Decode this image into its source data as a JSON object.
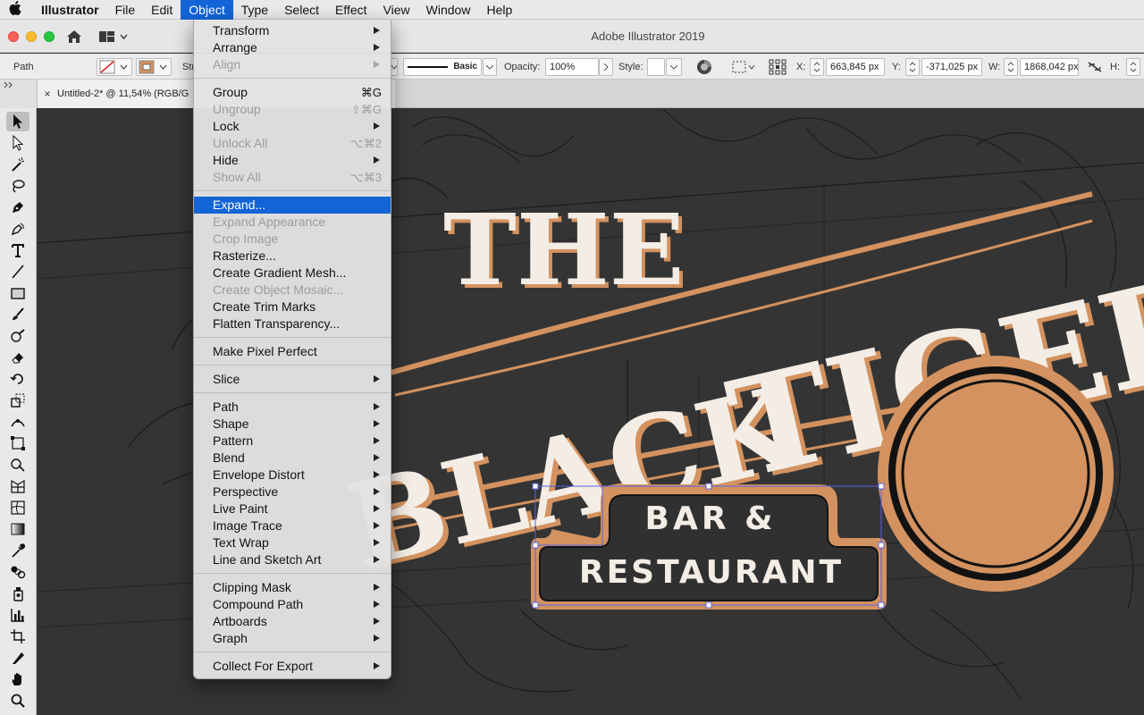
{
  "menubar": {
    "apple": "",
    "items": [
      "Illustrator",
      "File",
      "Edit",
      "Object",
      "Type",
      "Select",
      "Effect",
      "View",
      "Window",
      "Help"
    ]
  },
  "window": {
    "title": "Adobe Illustrator 2019"
  },
  "control_bar": {
    "selection_label": "Path",
    "stroke_label": "Str",
    "brush_label": "Basic",
    "opacity_label": "Opacity:",
    "opacity_value": "100%",
    "style_label": "Style:",
    "x_label": "X:",
    "x_value": "663,845 px",
    "y_label": "Y:",
    "y_value": "-371,025 px",
    "w_label": "W:",
    "w_value": "1868,042 px",
    "h_label": "H:"
  },
  "document_tab": {
    "label": "Untitled-2* @ 11,54% (RGB/G",
    "close": "×"
  },
  "object_menu": {
    "groups": [
      [
        {
          "label": "Transform",
          "submenu": true
        },
        {
          "label": "Arrange",
          "submenu": true
        },
        {
          "label": "Align",
          "submenu": true,
          "disabled": true
        }
      ],
      [
        {
          "label": "Group",
          "shortcut": "⌘G"
        },
        {
          "label": "Ungroup",
          "shortcut": "⇧⌘G",
          "disabled": true
        },
        {
          "label": "Lock",
          "submenu": true
        },
        {
          "label": "Unlock All",
          "shortcut": "⌥⌘2",
          "disabled": true
        },
        {
          "label": "Hide",
          "submenu": true
        },
        {
          "label": "Show All",
          "shortcut": "⌥⌘3",
          "disabled": true
        }
      ],
      [
        {
          "label": "Expand...",
          "highlighted": true
        },
        {
          "label": "Expand Appearance",
          "disabled": true
        },
        {
          "label": "Crop Image",
          "disabled": true
        },
        {
          "label": "Rasterize..."
        },
        {
          "label": "Create Gradient Mesh..."
        },
        {
          "label": "Create Object Mosaic...",
          "disabled": true
        },
        {
          "label": "Create Trim Marks"
        },
        {
          "label": "Flatten Transparency..."
        }
      ],
      [
        {
          "label": "Make Pixel Perfect"
        }
      ],
      [
        {
          "label": "Slice",
          "submenu": true
        }
      ],
      [
        {
          "label": "Path",
          "submenu": true
        },
        {
          "label": "Shape",
          "submenu": true
        },
        {
          "label": "Pattern",
          "submenu": true
        },
        {
          "label": "Blend",
          "submenu": true
        },
        {
          "label": "Envelope Distort",
          "submenu": true
        },
        {
          "label": "Perspective",
          "submenu": true
        },
        {
          "label": "Live Paint",
          "submenu": true
        },
        {
          "label": "Image Trace",
          "submenu": true
        },
        {
          "label": "Text Wrap",
          "submenu": true
        },
        {
          "label": "Line and Sketch Art",
          "submenu": true
        }
      ],
      [
        {
          "label": "Clipping Mask",
          "submenu": true
        },
        {
          "label": "Compound Path",
          "submenu": true
        },
        {
          "label": "Artboards",
          "submenu": true
        },
        {
          "label": "Graph",
          "submenu": true
        }
      ],
      [
        {
          "label": "Collect For Export",
          "submenu": true
        }
      ]
    ]
  },
  "artwork": {
    "line1": "THE",
    "line2_part1": "BLACK",
    "line2_part2": "TIGER",
    "badge_line1": "BAR &",
    "badge_line2": "RESTAURANT"
  },
  "colors": {
    "accent_orange": "#d3925f",
    "cream": "#f3ede5",
    "canvas_bg": "#343434",
    "menu_highlight": "#1364d6",
    "selection_blue": "#5b61e3"
  }
}
